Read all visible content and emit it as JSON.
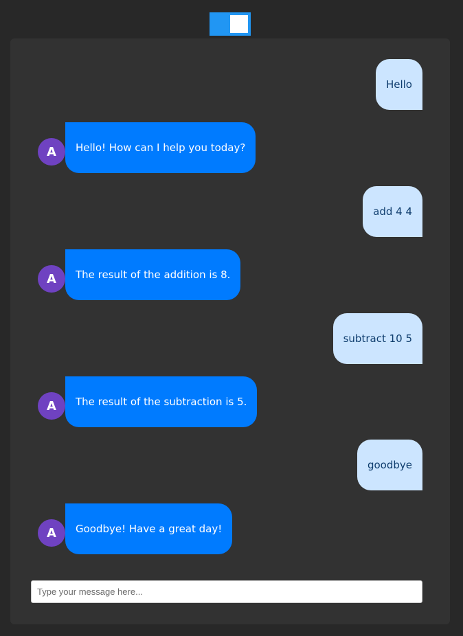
{
  "theme_toggle": {
    "state": "on",
    "accent": "#2196f3"
  },
  "chat": {
    "avatar_letter": "A",
    "messages": [
      {
        "sender": "user",
        "text": "Hello"
      },
      {
        "sender": "bot",
        "text": "Hello! How can I help you today?"
      },
      {
        "sender": "user",
        "text": "add 4 4"
      },
      {
        "sender": "bot",
        "text": "The result of the addition is 8."
      },
      {
        "sender": "user",
        "text": "subtract 10 5"
      },
      {
        "sender": "bot",
        "text": "The result of the subtraction is 5."
      },
      {
        "sender": "user",
        "text": "goodbye"
      },
      {
        "sender": "bot",
        "text": "Goodbye! Have a great day!"
      }
    ]
  },
  "composer": {
    "placeholder": "Type your message here..."
  },
  "colors": {
    "user_bubble": "#cce5ff",
    "bot_bubble": "#007bff",
    "avatar": "#6f42c1",
    "panel": "#323232",
    "background": "#282828"
  }
}
